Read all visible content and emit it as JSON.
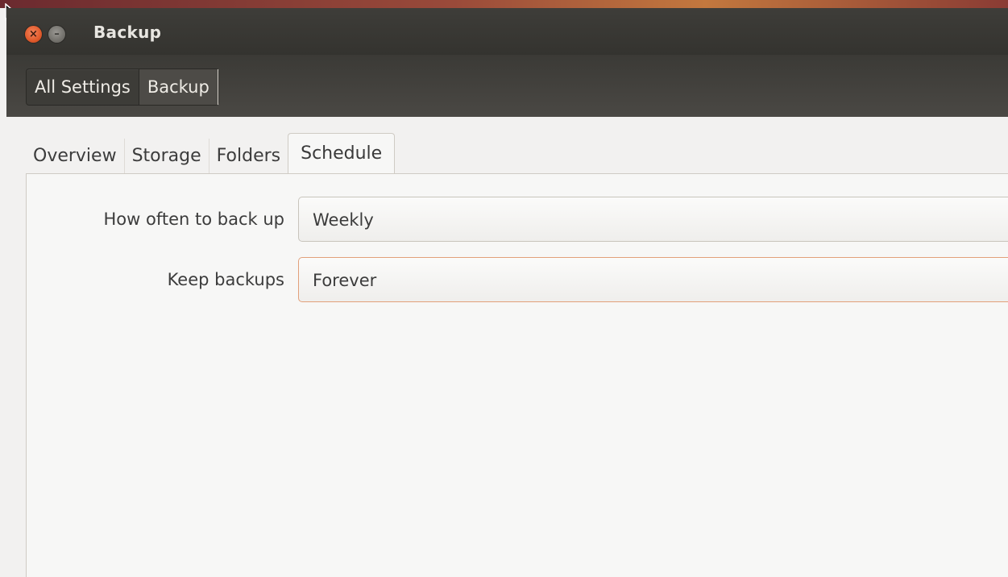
{
  "window": {
    "title": "Backup",
    "buttons": {
      "close_icon": "close-icon",
      "minimize_icon": "minimize-icon"
    }
  },
  "breadcrumb": {
    "items": [
      {
        "label": "All Settings"
      },
      {
        "label": "Backup"
      }
    ]
  },
  "tabs": [
    {
      "label": "Overview"
    },
    {
      "label": "Storage"
    },
    {
      "label": "Folders"
    },
    {
      "label": "Schedule",
      "selected": true
    }
  ],
  "schedule": {
    "frequency": {
      "label": "How often to back up",
      "value": "Weekly"
    },
    "retention": {
      "label": "Keep backups",
      "value": "Forever"
    }
  },
  "colors": {
    "accent": "#e05a2b",
    "titlebar": "#3e3d39",
    "focus_border": "#e2a07a"
  }
}
